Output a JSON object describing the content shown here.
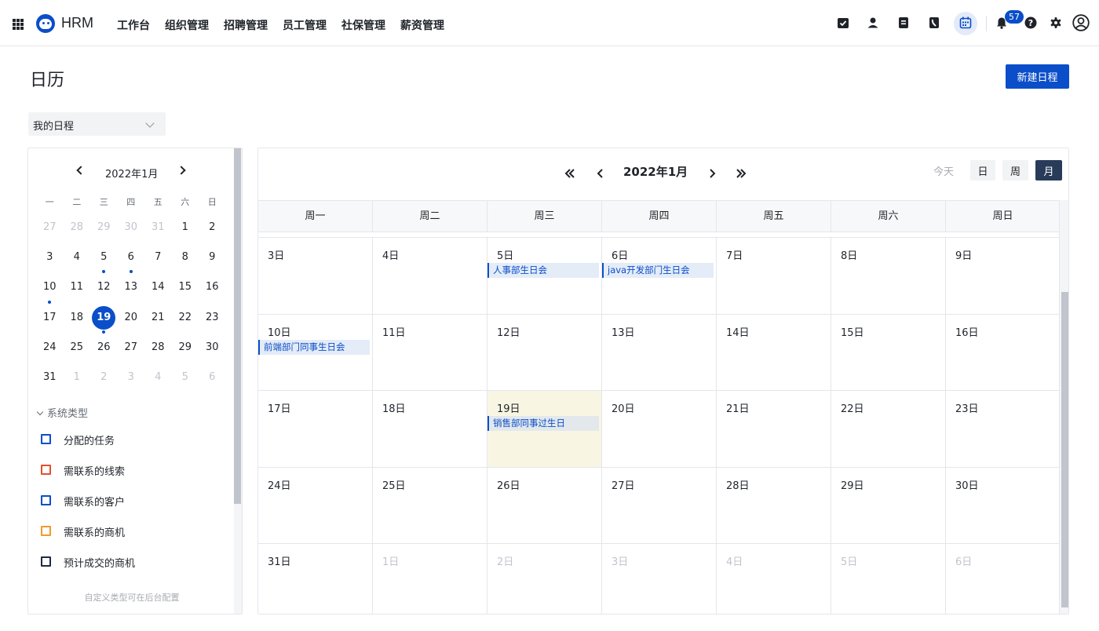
{
  "app": {
    "brand": "HRM",
    "nav": [
      "工作台",
      "组织管理",
      "招聘管理",
      "员工管理",
      "社保管理",
      "薪资管理"
    ],
    "notification_count": "57",
    "icons": [
      "checklist-icon",
      "user-icon",
      "document-icon",
      "contacts-icon",
      "calendar-icon",
      "bell-icon",
      "help-icon",
      "gear-icon",
      "account-icon"
    ],
    "accent_color": "#0b4ec9"
  },
  "page": {
    "title": "日历",
    "new_button": "新建日程",
    "filter_value": "我的日程"
  },
  "mini_calendar": {
    "title": "2022年1月",
    "weekdays": [
      "一",
      "二",
      "三",
      "四",
      "五",
      "六",
      "日"
    ],
    "weeks": [
      [
        {
          "d": "27",
          "other": true
        },
        {
          "d": "28",
          "other": true
        },
        {
          "d": "29",
          "other": true
        },
        {
          "d": "30",
          "other": true
        },
        {
          "d": "31",
          "other": true
        },
        {
          "d": "1"
        },
        {
          "d": "2"
        }
      ],
      [
        {
          "d": "3"
        },
        {
          "d": "4"
        },
        {
          "d": "5",
          "dot": true
        },
        {
          "d": "6",
          "dot": true
        },
        {
          "d": "7"
        },
        {
          "d": "8"
        },
        {
          "d": "9"
        }
      ],
      [
        {
          "d": "10",
          "dot": true
        },
        {
          "d": "11"
        },
        {
          "d": "12"
        },
        {
          "d": "13"
        },
        {
          "d": "14"
        },
        {
          "d": "15"
        },
        {
          "d": "16"
        }
      ],
      [
        {
          "d": "17"
        },
        {
          "d": "18"
        },
        {
          "d": "19",
          "selected": true,
          "dot": true
        },
        {
          "d": "20"
        },
        {
          "d": "21"
        },
        {
          "d": "22"
        },
        {
          "d": "23"
        }
      ],
      [
        {
          "d": "24"
        },
        {
          "d": "25"
        },
        {
          "d": "26"
        },
        {
          "d": "27"
        },
        {
          "d": "28"
        },
        {
          "d": "29"
        },
        {
          "d": "30"
        }
      ],
      [
        {
          "d": "31"
        },
        {
          "d": "1",
          "other": true
        },
        {
          "d": "2",
          "other": true
        },
        {
          "d": "3",
          "other": true
        },
        {
          "d": "4",
          "other": true
        },
        {
          "d": "5",
          "other": true
        },
        {
          "d": "6",
          "other": true
        }
      ]
    ]
  },
  "types": {
    "header": "系统类型",
    "items": [
      {
        "label": "分配的任务",
        "color": "#0b4ec9"
      },
      {
        "label": "需联系的线索",
        "color": "#e0502e"
      },
      {
        "label": "需联系的客户",
        "color": "#0b4ec9"
      },
      {
        "label": "需联系的商机",
        "color": "#f39a2b"
      },
      {
        "label": "预计成交的商机",
        "color": "#1f2a44"
      }
    ],
    "note": "自定义类型可在后台配置"
  },
  "calendar": {
    "title": "2022年1月",
    "views": [
      "今天",
      "日",
      "周",
      "月"
    ],
    "active_view": "月",
    "weekdays": [
      "周一",
      "周二",
      "周三",
      "周四",
      "周五",
      "周六",
      "周日"
    ],
    "weeks": [
      [
        {
          "d": "3日"
        },
        {
          "d": "4日"
        },
        {
          "d": "5日",
          "event": "人事部生日会"
        },
        {
          "d": "6日",
          "event": "java开发部门生日会"
        },
        {
          "d": "7日"
        },
        {
          "d": "8日"
        },
        {
          "d": "9日"
        }
      ],
      [
        {
          "d": "10日",
          "event": "前端部门同事生日会"
        },
        {
          "d": "11日"
        },
        {
          "d": "12日"
        },
        {
          "d": "13日"
        },
        {
          "d": "14日"
        },
        {
          "d": "15日"
        },
        {
          "d": "16日"
        }
      ],
      [
        {
          "d": "17日"
        },
        {
          "d": "18日"
        },
        {
          "d": "19日",
          "event": "销售部同事过生日",
          "today": true
        },
        {
          "d": "20日"
        },
        {
          "d": "21日"
        },
        {
          "d": "22日"
        },
        {
          "d": "23日"
        }
      ],
      [
        {
          "d": "24日"
        },
        {
          "d": "25日"
        },
        {
          "d": "26日"
        },
        {
          "d": "27日"
        },
        {
          "d": "28日"
        },
        {
          "d": "29日"
        },
        {
          "d": "30日"
        }
      ],
      [
        {
          "d": "31日"
        },
        {
          "d": "1日",
          "other": true
        },
        {
          "d": "2日",
          "other": true
        },
        {
          "d": "3日",
          "other": true
        },
        {
          "d": "4日",
          "other": true
        },
        {
          "d": "5日",
          "other": true
        },
        {
          "d": "6日",
          "other": true
        }
      ]
    ]
  }
}
